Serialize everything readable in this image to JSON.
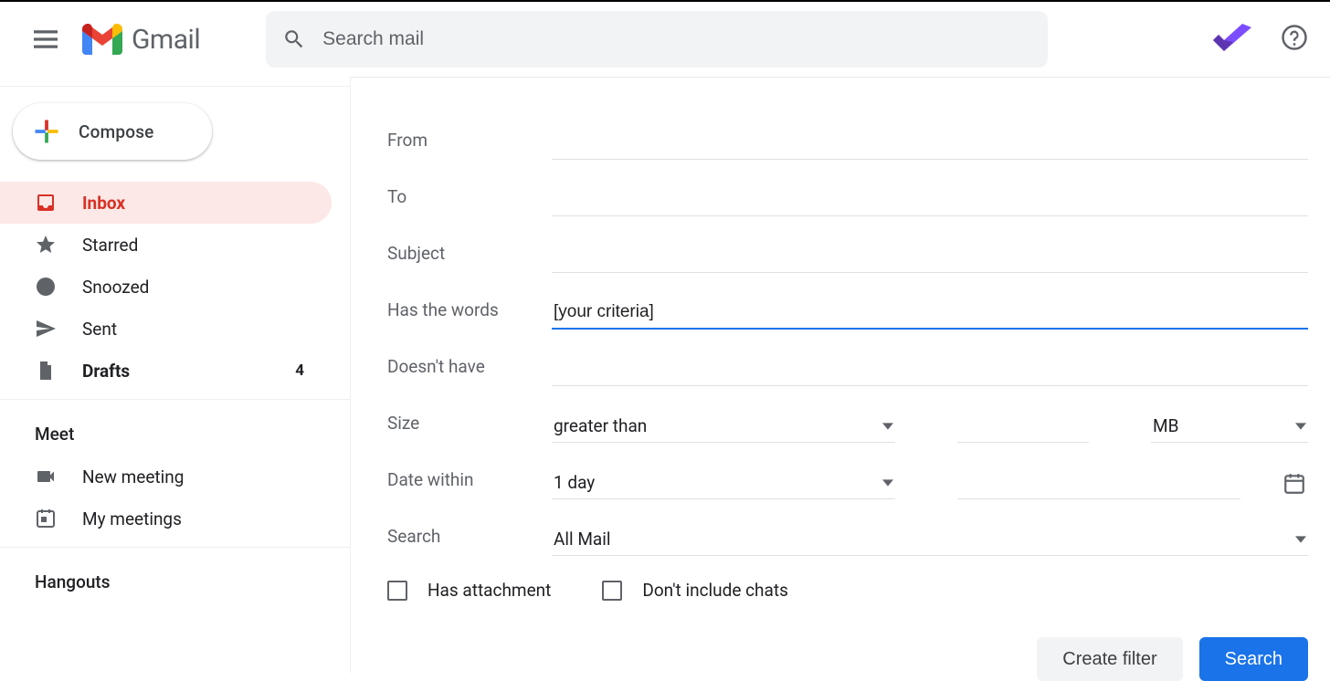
{
  "brand": "Gmail",
  "search": {
    "placeholder": "Search mail"
  },
  "sidebar": {
    "compose": "Compose",
    "items": [
      {
        "label": "Inbox",
        "active": true
      },
      {
        "label": "Starred"
      },
      {
        "label": "Snoozed"
      },
      {
        "label": "Sent"
      },
      {
        "label": "Drafts",
        "bold": true,
        "count": "4"
      }
    ],
    "meet_header": "Meet",
    "meet": [
      {
        "label": "New meeting"
      },
      {
        "label": "My meetings"
      }
    ],
    "hangouts_header": "Hangouts"
  },
  "filter": {
    "labels": {
      "from": "From",
      "to": "To",
      "subject": "Subject",
      "has_words": "Has the words",
      "doesnt_have": "Doesn't have",
      "size": "Size",
      "date_within": "Date within",
      "search": "Search"
    },
    "values": {
      "from": "",
      "to": "",
      "subject": "",
      "has_words": "[your criteria]",
      "doesnt_have": "",
      "size_op": "greater than",
      "size_val": "",
      "size_unit": "MB",
      "date_range": "1 day",
      "date_val": "",
      "search_in": "All Mail"
    },
    "checks": {
      "has_attachment": "Has attachment",
      "exclude_chats": "Don't include chats"
    },
    "actions": {
      "create_filter": "Create filter",
      "search": "Search"
    }
  }
}
